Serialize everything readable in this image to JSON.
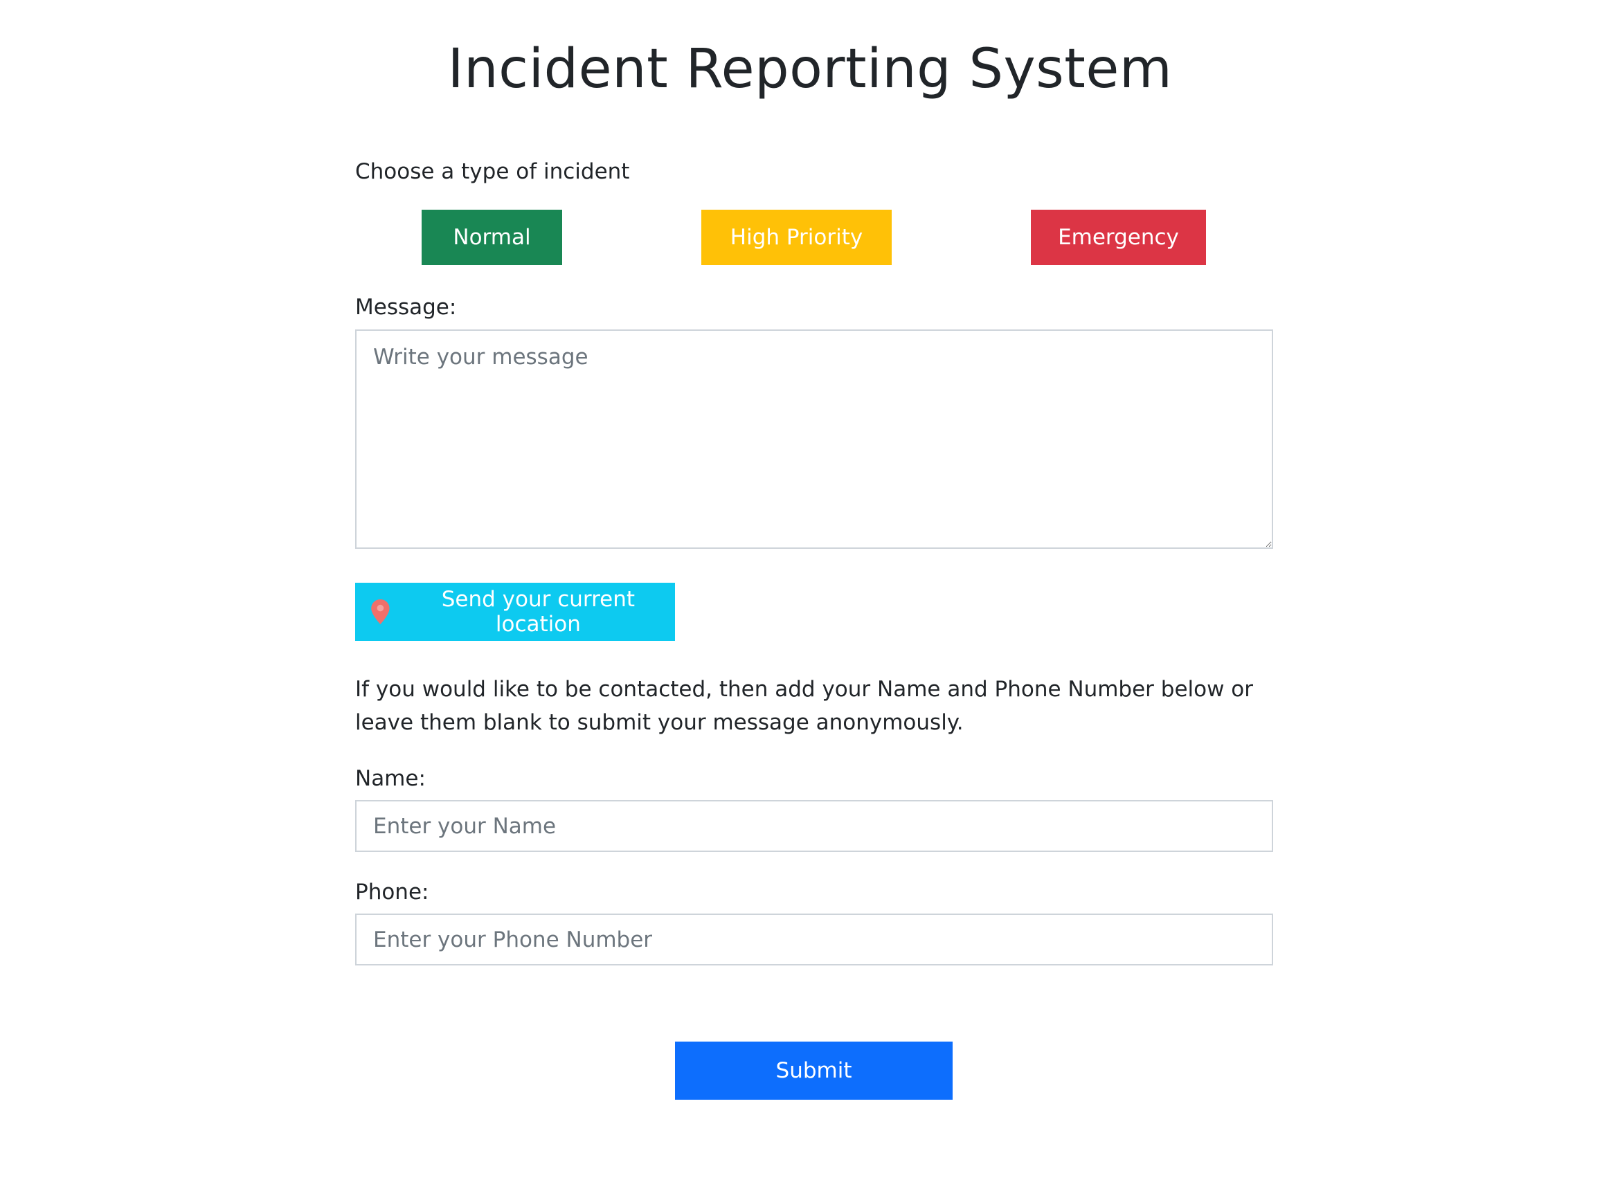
{
  "page": {
    "title": "Incident Reporting System"
  },
  "incident_type": {
    "prompt": "Choose a type of incident",
    "options": [
      {
        "label": "Normal",
        "color": "#198754"
      },
      {
        "label": "High Priority",
        "color": "#ffc107"
      },
      {
        "label": "Emergency",
        "color": "#dc3545"
      }
    ]
  },
  "message": {
    "label": "Message:",
    "placeholder": "Write your message",
    "value": ""
  },
  "location": {
    "button_label": "Send your current location",
    "icon": "map-pin-icon",
    "icon_color": "#f0706a",
    "button_color": "#0dcaf0"
  },
  "contact": {
    "info": "If you would like to be contacted, then add your Name and Phone Number below or leave them blank to submit your message anonymously.",
    "name": {
      "label": "Name:",
      "placeholder": "Enter your Name",
      "value": ""
    },
    "phone": {
      "label": "Phone:",
      "placeholder": "Enter your Phone Number",
      "value": ""
    }
  },
  "submit": {
    "label": "Submit",
    "color": "#0d6efd"
  }
}
